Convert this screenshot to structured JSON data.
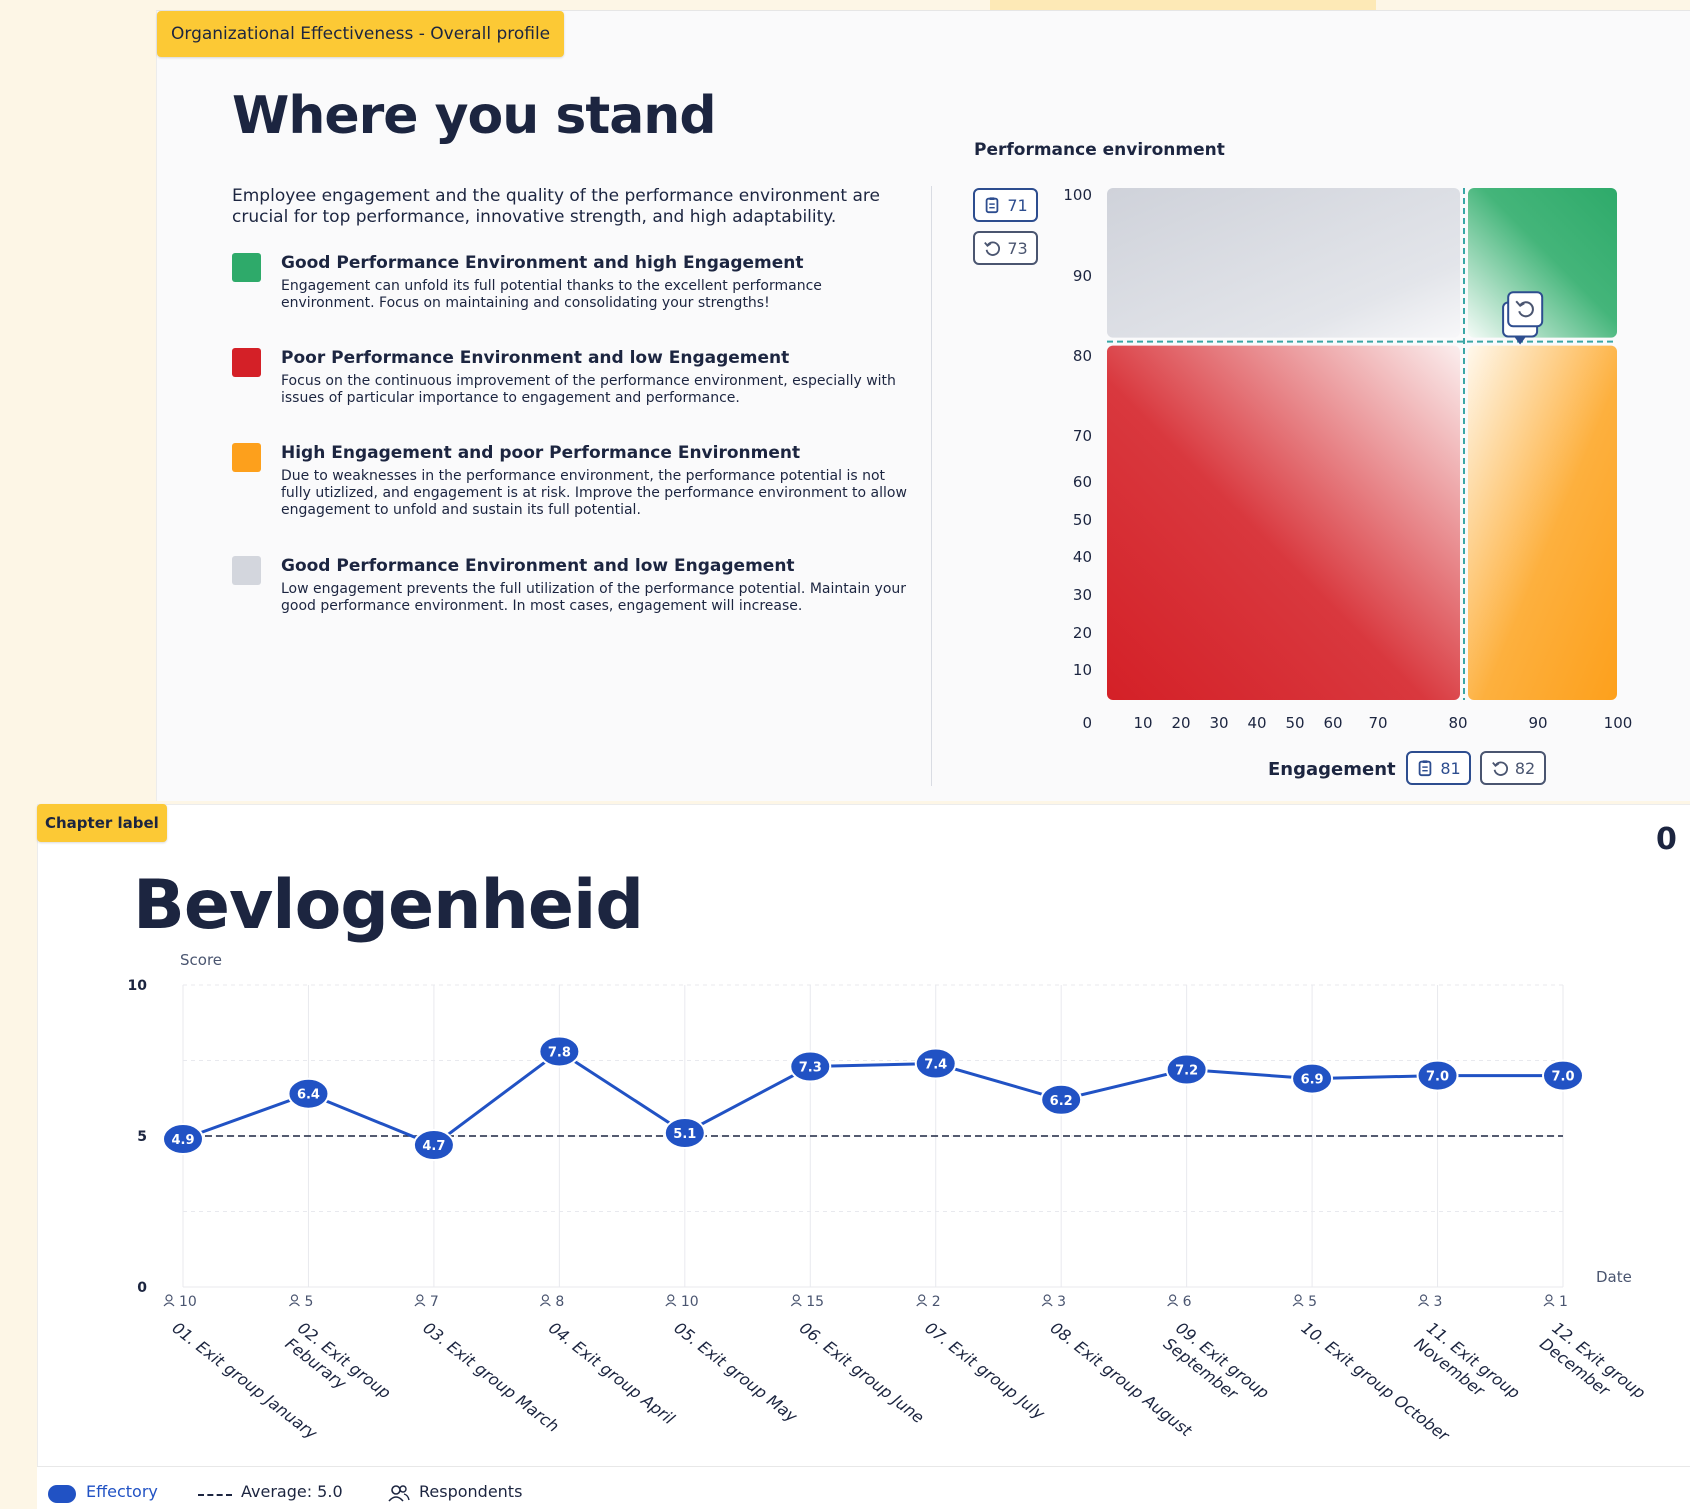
{
  "panel1": {
    "chip_label": "Organizational Effectiveness - Overall profile",
    "title": "Where you stand",
    "intro": "Employee engagement and the quality of the performance environment are crucial for top performance, innovative strength, and high adaptability.",
    "legend": [
      {
        "title": "Good Performance Environment and high Engagement",
        "desc": "Engagement can unfold its full potential thanks to the excellent performance environment. Focus on maintaining and consolidating your strengths!",
        "color": "#2eaa6a"
      },
      {
        "title": "Poor Performance Environment and low Engagement",
        "desc": "Focus on the continuous improvement of the performance environment, especially with issues of particular importance to engagement and performance.",
        "color": "#d42027"
      },
      {
        "title": "High Engagement and poor Performance Environment",
        "desc": "Due to weaknesses in the performance environment, the performance potential is not fully utizlized, and engagement is at risk. Improve the performance environment to allow engagement to unfold and sustain its full potential.",
        "color": "#fda01c"
      },
      {
        "title": "Good Performance Environment and low Engagement",
        "desc": "Low engagement prevents the full utilization of the performance potential. Maintain your good performance environment. In most cases, engagement will increase.",
        "color": "#d3d6dd"
      }
    ]
  },
  "quadrant": {
    "y_title": "Performance environment",
    "x_title": "Engagement",
    "y_badges": [
      {
        "icon": "clipboard-icon",
        "value": "71"
      },
      {
        "icon": "history-icon",
        "value": "73"
      }
    ],
    "x_badges": [
      {
        "icon": "clipboard-icon",
        "value": "81"
      },
      {
        "icon": "history-icon",
        "value": "82"
      }
    ],
    "y_ticks": [
      "100",
      "90",
      "80",
      "70",
      "60",
      "50",
      "40",
      "30",
      "20",
      "10",
      "0"
    ],
    "x_ticks": [
      "10",
      "20",
      "30",
      "40",
      "50",
      "60",
      "70",
      "80",
      "90",
      "100"
    ],
    "threshold": 70,
    "markers": [
      {
        "icon": "clipboard-icon",
        "engagement": 81,
        "performance": 71
      },
      {
        "icon": "history-icon",
        "engagement": 82,
        "performance": 73
      }
    ]
  },
  "panel2": {
    "chip_label": "Chapter label",
    "title": "Bevlogenheid",
    "corner_icon": "0"
  },
  "chart_data": {
    "type": "line",
    "ylabel": "Score",
    "xlabel": "Date",
    "ylim": [
      0,
      10
    ],
    "y_ticks": [
      "10",
      "5",
      "0"
    ],
    "categories": [
      "01. Exit group January",
      "02. Exit group Feburary",
      "03. Exit group March",
      "04. Exit group April",
      "05. Exit group May",
      "06. Exit group June",
      "07. Exit group July",
      "08. Exit group August",
      "09. Exit group September",
      "10. Exit group October",
      "11. Exit group November",
      "12. Exit group December"
    ],
    "series": [
      {
        "name": "Effectory",
        "values": [
          4.9,
          6.4,
          4.7,
          7.8,
          5.1,
          7.3,
          7.4,
          6.2,
          7.2,
          6.9,
          7.0,
          7.0
        ],
        "color": "#2152c4"
      }
    ],
    "value_labels": [
      "4.9",
      "6.4",
      "4.7",
      "7.8",
      "5.1",
      "7.3",
      "7.4",
      "6.2",
      "7.2",
      "6.9",
      "7.0",
      "7.0"
    ],
    "respondents": [
      10,
      5,
      7,
      8,
      10,
      15,
      2,
      3,
      6,
      5,
      3,
      1
    ],
    "average": 5.0,
    "legend": {
      "series": "Effectory",
      "average": "Average: 5.0",
      "respondents": "Respondents"
    },
    "grid": true
  }
}
